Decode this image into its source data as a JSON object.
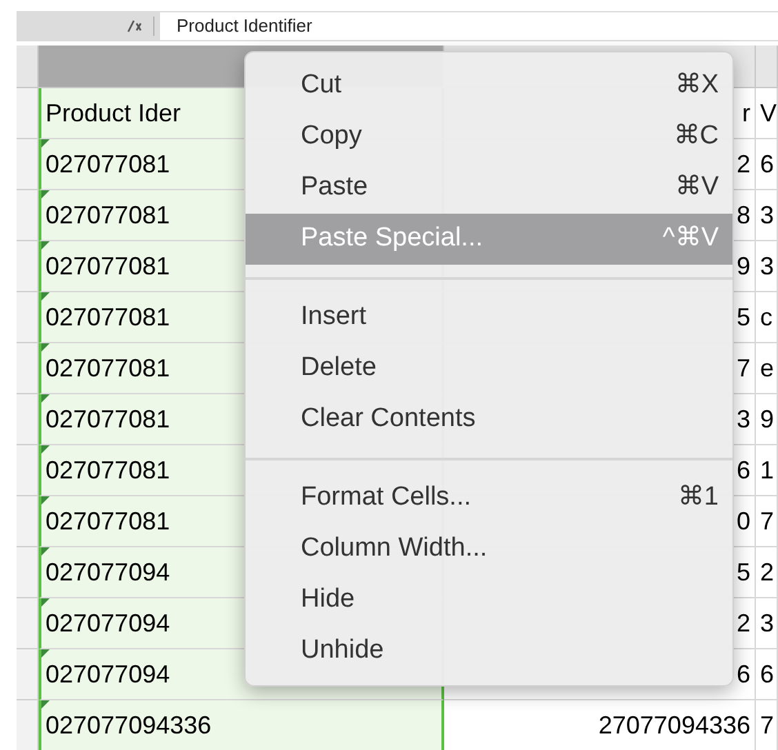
{
  "formula_bar": {
    "content": "Product Identifier"
  },
  "columns": [
    {
      "selected": true
    },
    {
      "selected": false
    },
    {
      "selected": false
    }
  ],
  "rows": [
    {
      "cells": [
        "Product Ider",
        "r",
        "V"
      ]
    },
    {
      "cells": [
        "027077081",
        "2",
        "6"
      ]
    },
    {
      "cells": [
        "027077081",
        "8",
        "3"
      ]
    },
    {
      "cells": [
        "027077081",
        "9",
        "3"
      ]
    },
    {
      "cells": [
        "027077081",
        "5",
        "c"
      ]
    },
    {
      "cells": [
        "027077081",
        "7",
        "e"
      ]
    },
    {
      "cells": [
        "027077081",
        "3",
        "9"
      ]
    },
    {
      "cells": [
        "027077081",
        "6",
        "1"
      ]
    },
    {
      "cells": [
        "027077081",
        "0",
        "7"
      ]
    },
    {
      "cells": [
        "027077094",
        "5",
        "2"
      ]
    },
    {
      "cells": [
        "027077094",
        "2",
        "3"
      ]
    },
    {
      "cells": [
        "027077094",
        "6",
        "6"
      ]
    },
    {
      "cells": [
        "027077094336",
        "27077094336",
        "7"
      ]
    }
  ],
  "context_menu": [
    {
      "kind": "item",
      "label": "Cut",
      "shortcut": "⌘X",
      "selected": false
    },
    {
      "kind": "item",
      "label": "Copy",
      "shortcut": "⌘C",
      "selected": false
    },
    {
      "kind": "item",
      "label": "Paste",
      "shortcut": "⌘V",
      "selected": false
    },
    {
      "kind": "item",
      "label": "Paste Special...",
      "shortcut": "^⌘V",
      "selected": true
    },
    {
      "kind": "separator"
    },
    {
      "kind": "item",
      "label": "Insert",
      "selected": false
    },
    {
      "kind": "item",
      "label": "Delete",
      "selected": false
    },
    {
      "kind": "item",
      "label": "Clear Contents",
      "selected": false
    },
    {
      "kind": "separator"
    },
    {
      "kind": "item",
      "label": "Format Cells...",
      "shortcut": "⌘1",
      "selected": false
    },
    {
      "kind": "item",
      "label": "Column Width...",
      "selected": false
    },
    {
      "kind": "item",
      "label": "Hide",
      "selected": false
    },
    {
      "kind": "item",
      "label": "Unhide",
      "selected": false
    }
  ]
}
